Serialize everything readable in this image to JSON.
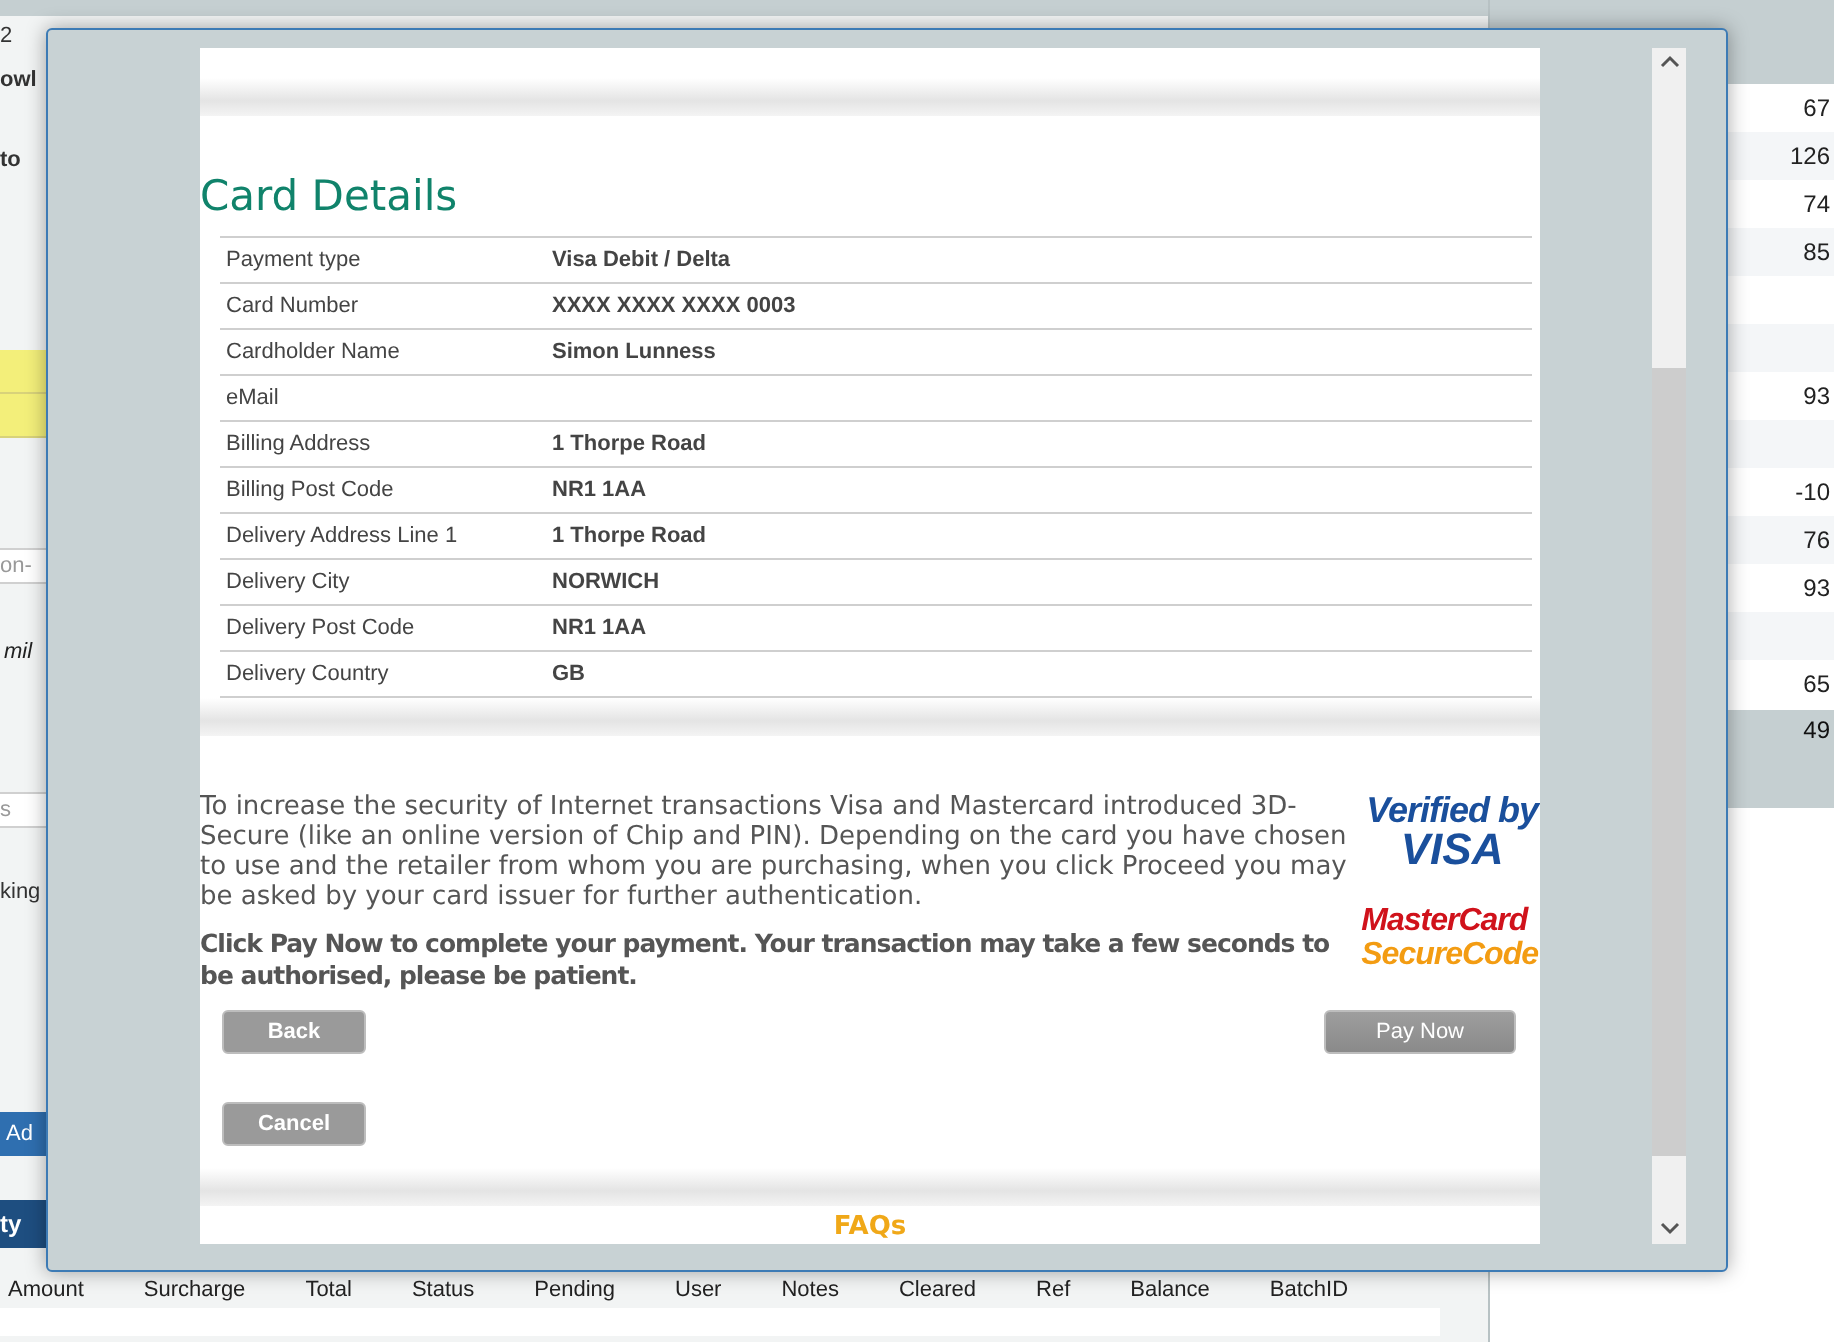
{
  "background": {
    "left_items": [
      {
        "text": "2",
        "kind": "plain"
      },
      {
        "text": "owl",
        "kind": "bold"
      },
      {
        "text": "to",
        "kind": "bold"
      },
      {
        "kind": "yellow"
      },
      {
        "kind": "yellow"
      },
      {
        "text": "on-",
        "kind": "hint"
      },
      {
        "text": "mil",
        "kind": "italic"
      },
      {
        "text": "s",
        "kind": "hint"
      },
      {
        "text": "king",
        "kind": "plain"
      },
      {
        "text": "Ad",
        "kind": "button"
      },
      {
        "text": "ty",
        "kind": "tab"
      }
    ],
    "columns": [
      "Amount",
      "Surcharge",
      "Total",
      "Status",
      "Pending",
      "User",
      "Notes",
      "Cleared",
      "Ref",
      "Balance",
      "BatchID"
    ],
    "right_values": [
      "67",
      "126",
      "74",
      "85",
      "93",
      "-10",
      "76",
      "93",
      "65",
      "49"
    ]
  },
  "dialog": {
    "title": "Card Details",
    "fields": [
      {
        "label": "Payment type",
        "value": "Visa Debit / Delta"
      },
      {
        "label": "Card Number",
        "value": "XXXX XXXX XXXX 0003"
      },
      {
        "label": "Cardholder Name",
        "value": "Simon Lunness"
      },
      {
        "label": "eMail"
      },
      {
        "label": "Billing Address",
        "value": "1 Thorpe Road"
      },
      {
        "label": "Billing Post Code",
        "value": "NR1 1AA"
      },
      {
        "label": "Delivery Address Line 1",
        "value": "1 Thorpe Road"
      },
      {
        "label": "Delivery City",
        "value": "NORWICH"
      },
      {
        "label": "Delivery Post Code",
        "value": "NR1 1AA"
      },
      {
        "label": "Delivery Country",
        "value": "GB"
      }
    ],
    "info": "To increase the security of Internet transactions Visa and Mastercard introduced 3D-Secure (like an online version of Chip and PIN). Depending on the card you have chosen to use and the retailer from whom you are purchasing, when you click Proceed you may be asked by your card issuer for further authentication.",
    "notice": "Click Pay Now to complete your payment. Your transaction may take a few seconds to be authorised, please be patient.",
    "visa_logo": {
      "line_1": "Verified by",
      "line_2": "VISA"
    },
    "mastercard_logo": {
      "line_1": "MasterCard",
      "line_2": "SecureCode"
    },
    "back_button": "Back",
    "pay_button": "Pay Now",
    "cancel_button": "Cancel",
    "faqs": "FAQs"
  }
}
